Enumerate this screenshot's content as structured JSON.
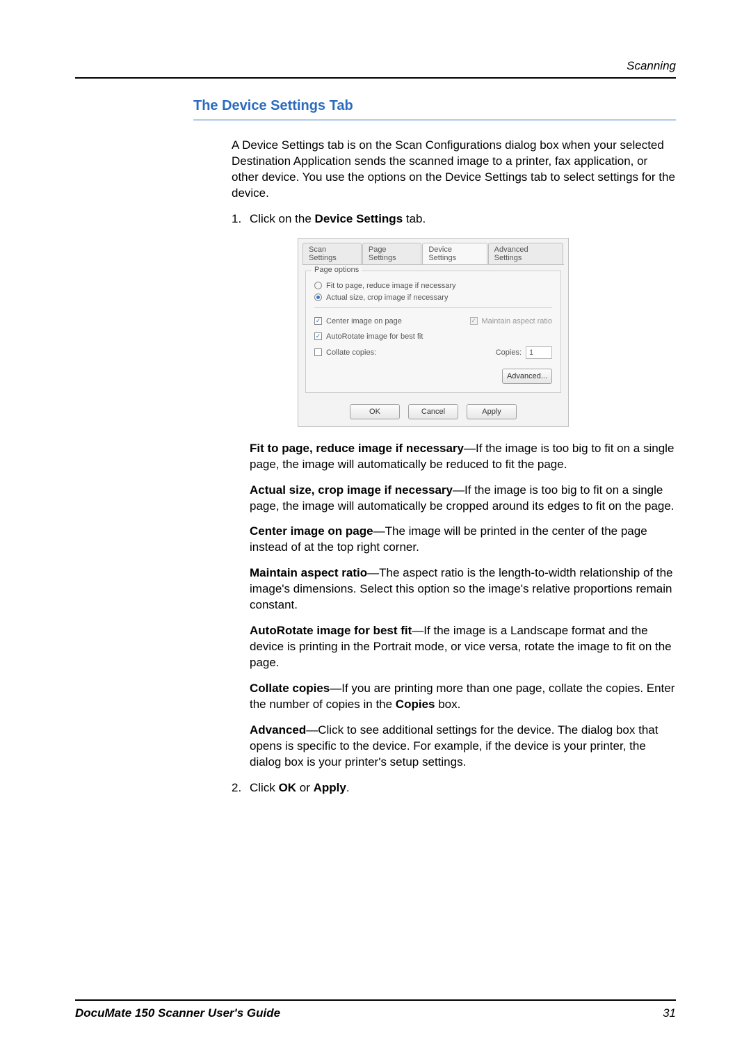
{
  "header": {
    "section": "Scanning"
  },
  "title": "The Device Settings Tab",
  "intro": "A Device Settings tab is on the Scan Configurations dialog box when your selected Destination Application sends the scanned image to a printer, fax application, or other device. You use the options on the Device Settings tab to select settings for the device.",
  "step1_num": "1.",
  "step1_pre": "Click on the ",
  "step1_bold": "Device Settings",
  "step1_post": " tab.",
  "dialog": {
    "tabs": [
      "Scan Settings",
      "Page Settings",
      "Device Settings",
      "Advanced Settings"
    ],
    "active_tab_index": 2,
    "group_title": "Page options",
    "radio1": "Fit to page, reduce image if necessary",
    "radio2": "Actual size, crop image if necessary",
    "radio_selected": 1,
    "check_center": "Center image on page",
    "check_aspect": "Maintain aspect ratio",
    "check_autorotate": "AutoRotate image for best fit",
    "check_collate": "Collate copies:",
    "copies_label": "Copies:",
    "copies_value": "1",
    "advanced_btn": "Advanced...",
    "ok": "OK",
    "cancel": "Cancel",
    "apply": "Apply"
  },
  "defs": [
    {
      "term": "Fit to page, reduce image if necessary",
      "text": "—If the image is too big to fit on a single page, the image will automatically be reduced to fit the page."
    },
    {
      "term": "Actual size, crop image if necessary",
      "text": "—If the image is too big to fit on a single page, the image will automatically be cropped around its edges to fit on the page."
    },
    {
      "term": "Center image on page",
      "text": "—The image will be printed in the center of the page instead of at the top right corner."
    },
    {
      "term": "Maintain aspect ratio",
      "text": "—The aspect ratio is the length-to-width relationship of the image's dimensions. Select this option so the image's relative proportions remain constant."
    },
    {
      "term": "AutoRotate image for best fit",
      "text": "—If the image is a Landscape format and the device is printing in the Portrait mode, or vice versa, rotate the image to fit on the page."
    }
  ],
  "def_collate_term": "Collate copies",
  "def_collate_mid": "—If you are printing more than one page, collate the copies. Enter the number of copies in the ",
  "def_collate_bold": "Copies",
  "def_collate_end": " box.",
  "def_advanced_term": "Advanced",
  "def_advanced_text": "—Click to see additional settings for the device. The dialog box that opens is specific to the device. For example, if the device is your printer, the dialog box is your printer's setup settings.",
  "step2_num": "2.",
  "step2_pre": "Click ",
  "step2_b1": "OK",
  "step2_mid": " or ",
  "step2_b2": "Apply",
  "step2_end": ".",
  "footer": {
    "guide": "DocuMate 150 Scanner User's Guide",
    "page": "31"
  }
}
